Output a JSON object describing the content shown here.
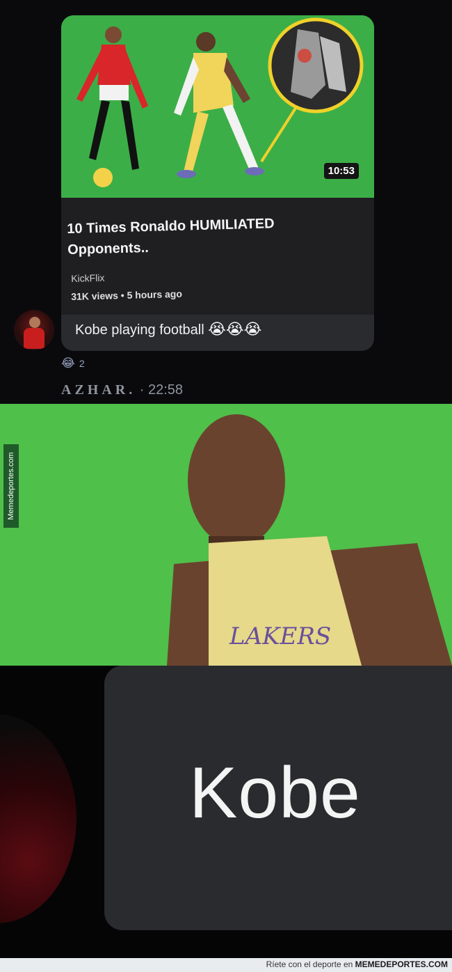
{
  "post": {
    "video": {
      "duration": "10:53",
      "title": "10 Times Ronaldo HUMILIATED Opponents..",
      "channel": "KickFlix",
      "meta": "31K views • 5 hours ago"
    },
    "caption": "Kobe playing football",
    "caption_emoji": "😭😭😭",
    "reaction": {
      "emoji": "😂",
      "count": "2"
    },
    "sender": {
      "name": "AZHAR.",
      "time": " · 22:58"
    }
  },
  "zoom": {
    "text": "Kobe"
  },
  "watermark": "Memedeportes.com",
  "footer": {
    "prefix": "Ríete con el deporte en ",
    "brand": "MEMEDEPORTES.COM"
  },
  "icons": {
    "avatar": "avatar-icon",
    "reaction": "laughing-emoji-icon"
  }
}
